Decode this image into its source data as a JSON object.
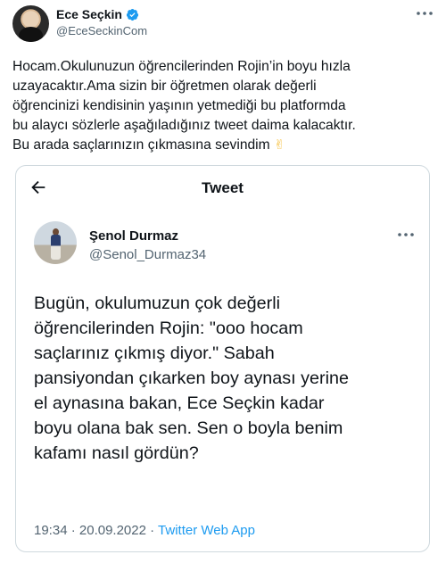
{
  "author": {
    "name": "Ece Seçkin",
    "handle": "@EceSeckinCom",
    "verified": true
  },
  "tweet": {
    "lines": [
      "Hocam.Okulunuzun  öğrencilerinden Rojin’in boyu hızla",
      "uzayacaktır.Ama sizin bir öğretmen olarak değerli",
      "öğrencinizi kendisinin yaşının yetmediği bu platformda",
      "bu alaycı sözlerle aşağıladığınız tweet daima kalacaktır.",
      "Bu arada saçlarınızın çıkmasına sevindim"
    ],
    "emoji": "✌"
  },
  "quoted": {
    "header_title": "Tweet",
    "author_name": "Şenol Durmaz",
    "author_handle": "@Senol_Durmaz34",
    "lines": [
      "Bugün, okulumuzun çok değerli",
      "öğrencilerinden Rojin: \"ooo hocam",
      "saçlarınız çıkmış diyor.\" Sabah",
      "pansiyondan çıkarken boy aynası yerine",
      "el aynasına bakan, Ece Seçkin kadar",
      "boyu olana bak sen. Sen o boyla benim",
      "kafamı nasıl gördün?"
    ],
    "time": "19:34",
    "date": "20.09.2022",
    "separator": "·",
    "source": "Twitter Web App"
  },
  "icons": {
    "verified": "verified-badge-icon",
    "more": "more-dots-icon",
    "back": "back-arrow-icon"
  },
  "colors": {
    "text": "#0f1419",
    "secondary": "#536471",
    "accent": "#1d9bf0",
    "border": "#cfd9de"
  }
}
